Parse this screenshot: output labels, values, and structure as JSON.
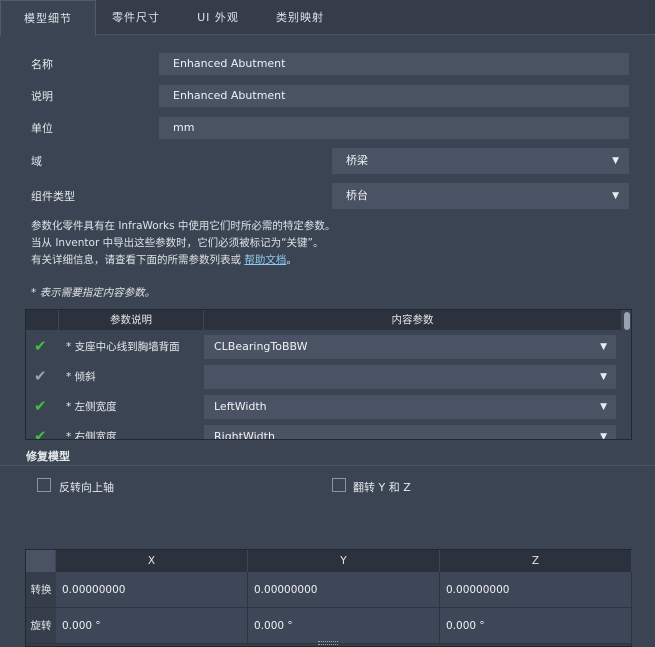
{
  "tabs": [
    {
      "label": "模型细节",
      "active": true
    },
    {
      "label": "零件尺寸",
      "active": false
    },
    {
      "label": "UI 外观",
      "active": false
    },
    {
      "label": "类别映射",
      "active": false
    }
  ],
  "form": {
    "name_label": "名称",
    "name_value": "Enhanced Abutment",
    "desc_label": "说明",
    "desc_value": "Enhanced Abutment",
    "unit_label": "单位",
    "unit_value": "mm",
    "domain_label": "域",
    "domain_value": "桥梁",
    "component_label": "组件类型",
    "component_value": "桥台"
  },
  "info": {
    "line1": "参数化零件具有在 InfraWorks 中使用它们时所必需的特定参数。",
    "line2": "当从 Inventor 中导出这些参数时，它们必须被标记为“关键”。",
    "line3_prefix": "有关详细信息，请查看下面的所需参数列表或",
    "help_link": "帮助文档",
    "line3_suffix": "。",
    "required_note": "* 表示需要指定内容参数。"
  },
  "param_table": {
    "col_param": "参数说明",
    "col_content": "内容参数",
    "rows": [
      {
        "param": "* 支座中心线到胸墙背面",
        "value": "CLBearingToBBW",
        "check_color": "#3fc23f"
      },
      {
        "param": "* 倾斜",
        "value": "",
        "check_color": "#9aa2ae"
      },
      {
        "param": "* 左侧宽度",
        "value": "LeftWidth",
        "check_color": "#3fc23f"
      },
      {
        "param": "* 右侧宽度",
        "value": "RightWidth",
        "check_color": "#3fc23f"
      }
    ]
  },
  "repair": {
    "title": "修复模型",
    "flip_label": "反转向上轴",
    "swap_label": "翻转 Y 和 Z"
  },
  "xyz_table": {
    "cols": [
      "X",
      "Y",
      "Z"
    ],
    "rows": [
      {
        "label": "转换",
        "values": [
          "0.00000000",
          "0.00000000",
          "0.00000000"
        ]
      },
      {
        "label": "旋转",
        "values": [
          "0.000 °",
          "0.000 °",
          "0.000 °"
        ]
      }
    ]
  },
  "icons": {
    "dropdown": "chevron-down-icon",
    "check": "checkmark-icon"
  }
}
